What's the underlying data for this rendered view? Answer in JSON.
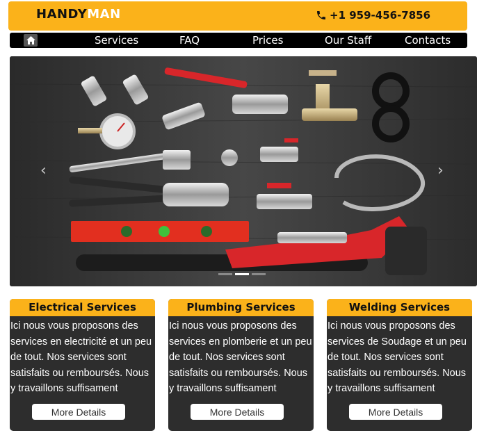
{
  "header": {
    "logo_main": "HANDY",
    "logo_accent": "MAN",
    "phone": "+1 959-456-7856",
    "phone_icon": "phone-icon"
  },
  "nav": {
    "home_icon": "home-icon",
    "items": [
      {
        "label": "Services"
      },
      {
        "label": "FAQ"
      },
      {
        "label": "Prices"
      },
      {
        "label": "Our Staff"
      },
      {
        "label": "Contacts"
      }
    ]
  },
  "slider": {
    "prev_icon": "chevron-left-icon",
    "next_icon": "chevron-right-icon",
    "prev_glyph": "‹",
    "next_glyph": "›",
    "slide_count": 3,
    "active_slide": 2,
    "image": "plumbing-tools-photo"
  },
  "cards": [
    {
      "title": "Electrical Services",
      "text": "Ici nous vous proposons des services en electricité et un peu de tout. Nos services sont satisfaits ou remboursés. Nous y travaillons suffisament",
      "button": "More Details"
    },
    {
      "title": "Plumbing Services",
      "text": "Ici nous vous proposons des services en plomberie et un peu de tout. Nos services sont satisfaits ou remboursés. Nous y travaillons suffisament",
      "button": "More Details"
    },
    {
      "title": "Welding Services",
      "text": "Ici nous vous proposons des services de Soudage et un peu de tout. Nos services sont satisfaits ou remboursés. Nous y travaillons suffisament",
      "button": "More Details"
    }
  ],
  "colors": {
    "accent": "#fbb21a",
    "nav_bg": "#000000",
    "card_bg": "#2d2d2d"
  }
}
